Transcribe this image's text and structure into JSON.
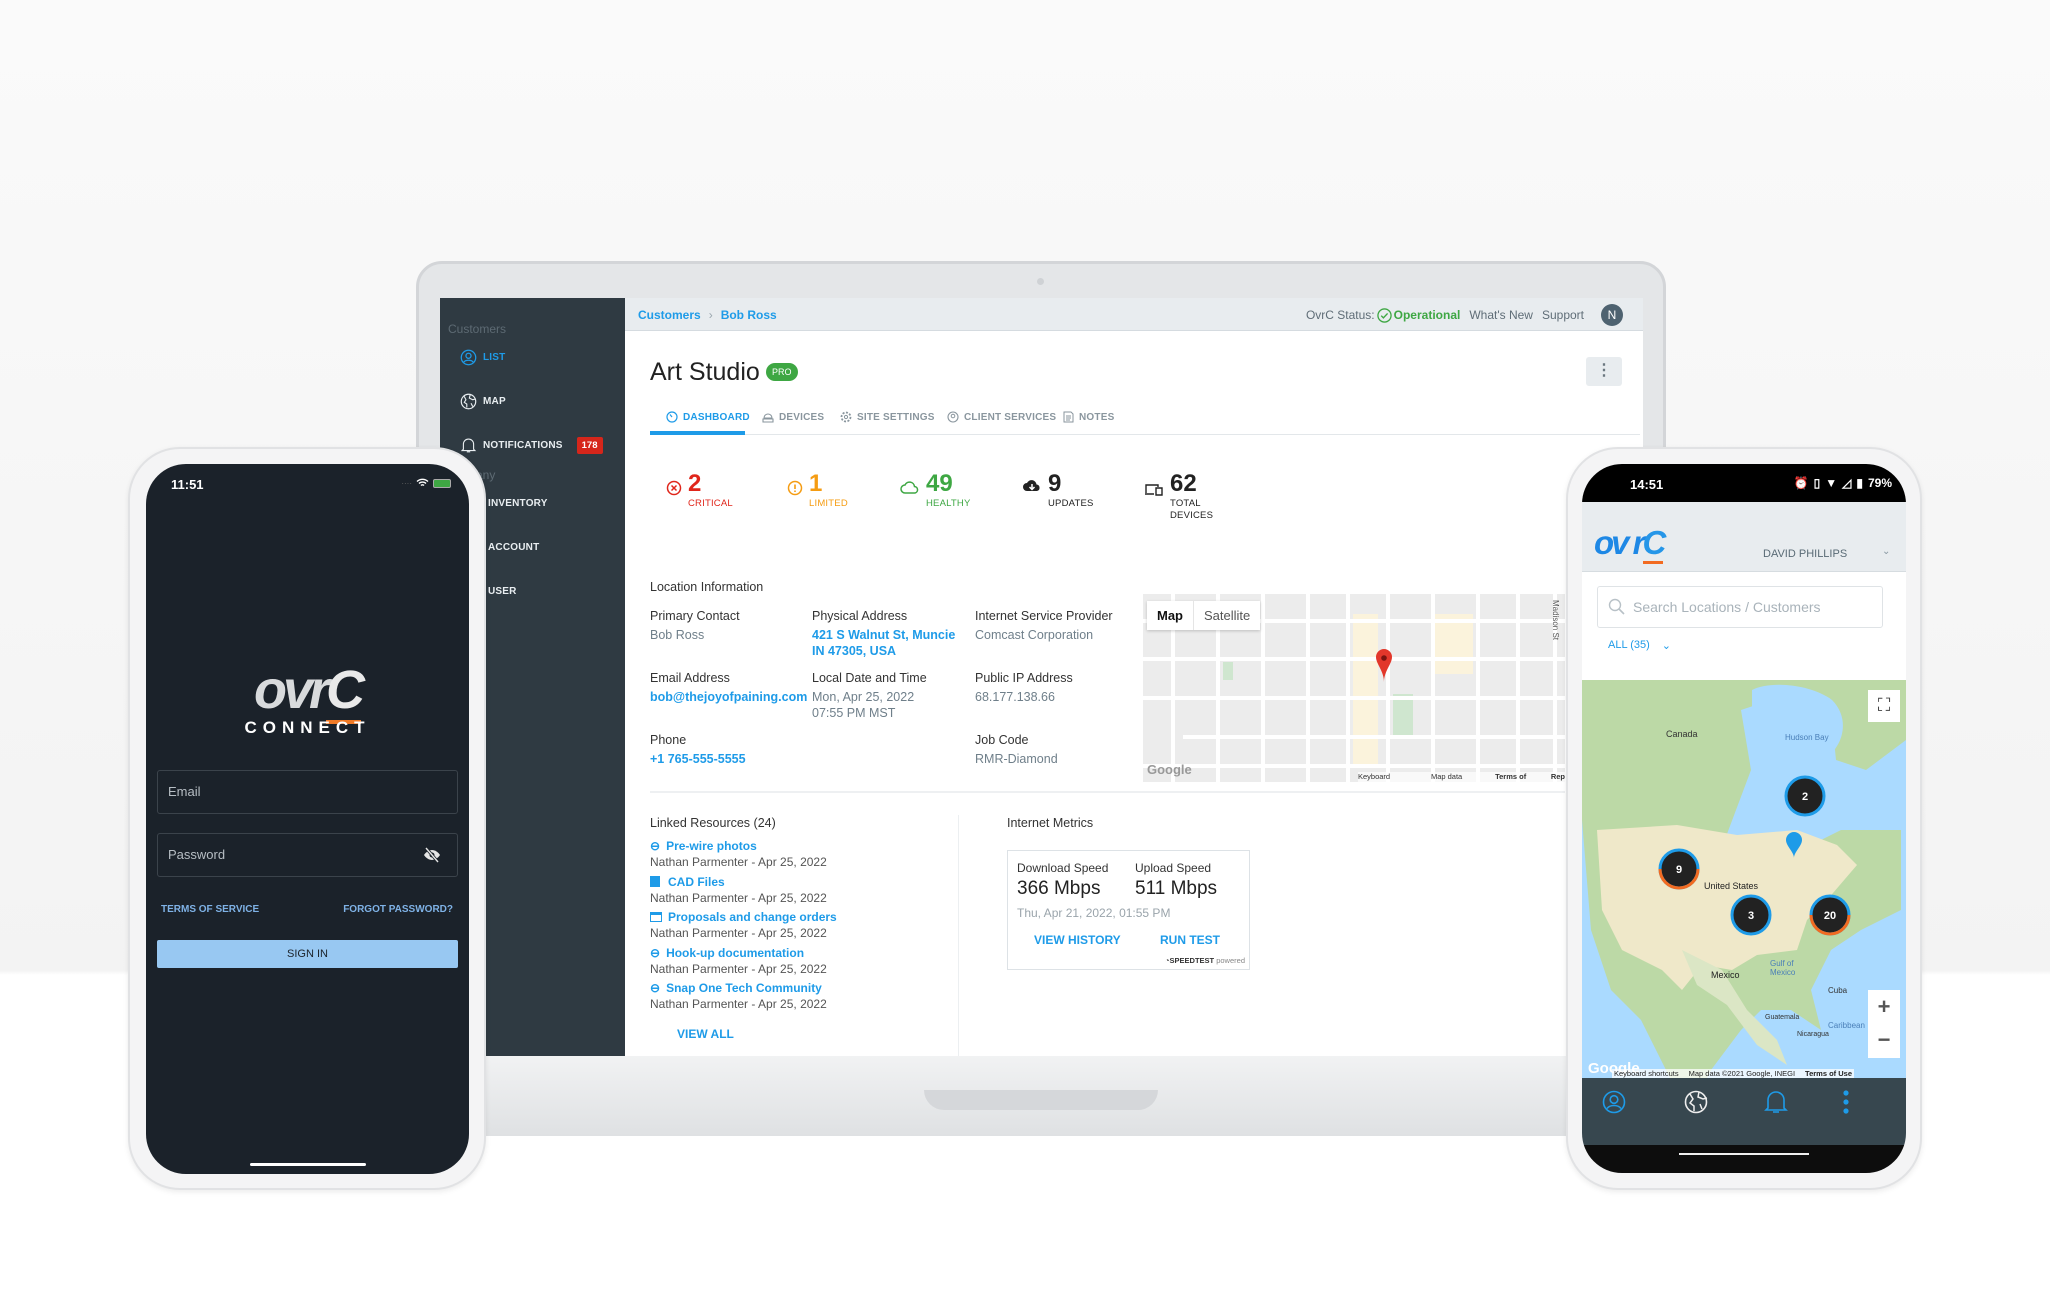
{
  "laptop": {
    "sidebar": {
      "section_customers": "Customers",
      "items": [
        {
          "label": "LIST",
          "icon": "user-circle-icon",
          "active": true
        },
        {
          "label": "MAP",
          "icon": "globe-icon"
        },
        {
          "label": "NOTIFICATIONS",
          "icon": "bell-icon",
          "badge": "178"
        },
        {
          "label": "INVENTORY"
        },
        {
          "label": "ACCOUNT"
        },
        {
          "label": "USER"
        }
      ],
      "section_company_partial": "any"
    },
    "header": {
      "breadcrumb": [
        "Customers",
        "Bob Ross"
      ],
      "status_label": "OvrC Status:",
      "status_value": "Operational",
      "whats_new": "What's New",
      "support": "Support",
      "avatar_initial": "N"
    },
    "site": {
      "title": "Art Studio",
      "badge": "PRO",
      "tabs": [
        {
          "label": "DASHBOARD",
          "active": true
        },
        {
          "label": "DEVICES"
        },
        {
          "label": "SITE SETTINGS"
        },
        {
          "label": "CLIENT SERVICES"
        },
        {
          "label": "NOTES"
        }
      ],
      "stats": [
        {
          "value": "2",
          "label": "CRITICAL",
          "color": "#e0261b"
        },
        {
          "value": "1",
          "label": "LIMITED",
          "color": "#f59c12"
        },
        {
          "value": "49",
          "label": "HEALTHY",
          "color": "#3ea743"
        },
        {
          "value": "9",
          "label": "UPDATES",
          "color": "#222222"
        },
        {
          "value": "62",
          "label": "TOTAL",
          "label2": "DEVICES",
          "color": "#222222"
        }
      ]
    },
    "location": {
      "heading": "Location Information",
      "primary_contact_label": "Primary Contact",
      "primary_contact": "Bob Ross",
      "address_label": "Physical Address",
      "address_line1": "421 S Walnut St, Muncie",
      "address_line2": "IN 47305, USA",
      "isp_label": "Internet Service Provider",
      "isp": "Comcast Corporation",
      "email_label": "Email Address",
      "email": "bob@thejoyofpaining.com",
      "datetime_label": "Local Date and Time",
      "date": "Mon, Apr 25, 2022",
      "time": "07:55 PM MST",
      "ip_label": "Public IP Address",
      "ip": "68.177.138.66",
      "phone_label": "Phone",
      "phone": "+1 765-555-5555",
      "job_label": "Job Code",
      "job": "RMR-Diamond",
      "map": {
        "map_tab": "Map",
        "satellite_tab": "Satellite",
        "street": "Madison St",
        "google": "Google",
        "shortcuts": "Keyboard shortcuts",
        "mapdata": "Map data ©2022",
        "terms": "Terms of Use",
        "report": "Rep"
      }
    },
    "resources": {
      "heading": "Linked Resources (24)",
      "items": [
        {
          "title": "Pre-wire photos",
          "meta": "Nathan Parmenter - Apr 25, 2022",
          "icon": "link-icon"
        },
        {
          "title": "CAD Files",
          "meta": "Nathan Parmenter - Apr 25, 2022",
          "icon": "image-file-icon"
        },
        {
          "title": "Proposals and change orders",
          "meta": "Nathan Parmenter - Apr 25, 2022",
          "icon": "folder-icon"
        },
        {
          "title": "Hook-up documentation",
          "meta": "Nathan Parmenter - Apr 25, 2022",
          "icon": "link-icon"
        },
        {
          "title": "Snap One Tech Community",
          "meta": "Nathan Parmenter - Apr 25, 2022",
          "icon": "link-icon"
        }
      ],
      "view_all": "VIEW ALL"
    },
    "metrics": {
      "heading": "Internet Metrics",
      "download_label": "Download Speed",
      "download": "366 Mbps",
      "upload_label": "Upload Speed",
      "upload": "511 Mbps",
      "date": "Thu, Apr 21, 2022, 01:55 PM",
      "view_history": "VIEW HISTORY",
      "run_test": "RUN TEST",
      "speedtest": "SPEEDTEST",
      "powered": "powered"
    }
  },
  "login_phone": {
    "time": "11:51",
    "logo_word": "OvrC",
    "logo_sub": "CONNECT",
    "email_placeholder": "Email",
    "password_placeholder": "Password",
    "terms": "TERMS OF SERVICE",
    "forgot": "FORGOT PASSWORD?",
    "sign_in": "SIGN IN"
  },
  "map_phone": {
    "time": "14:51",
    "battery": "79%",
    "logo_word": "OvrC",
    "user": "DAVID PHILLIPS",
    "search_placeholder": "Search Locations / Customers",
    "filter": "ALL (35)",
    "labels": {
      "canada": "Canada",
      "hudson": "Hudson Bay",
      "us": "United States",
      "mexico": "Mexico",
      "gulf": "Gulf of Mexico",
      "cuba": "Cuba",
      "guatemala": "Guatemala",
      "nicaragua": "Nicaragua",
      "caribbean": "Caribbean"
    },
    "clusters": [
      "2",
      "9",
      "3",
      "20"
    ],
    "attrib_shortcuts": "Keyboard shortcuts",
    "attrib_data": "Map data ©2021 Google, INEGI",
    "attrib_terms": "Terms of Use",
    "google": "Google"
  },
  "colors": {
    "accent": "#1e9be8",
    "sidebar": "#2f3a42",
    "ok": "#3ea743",
    "critical": "#e0261b",
    "limited": "#f59c12",
    "orange": "#f26b21"
  }
}
